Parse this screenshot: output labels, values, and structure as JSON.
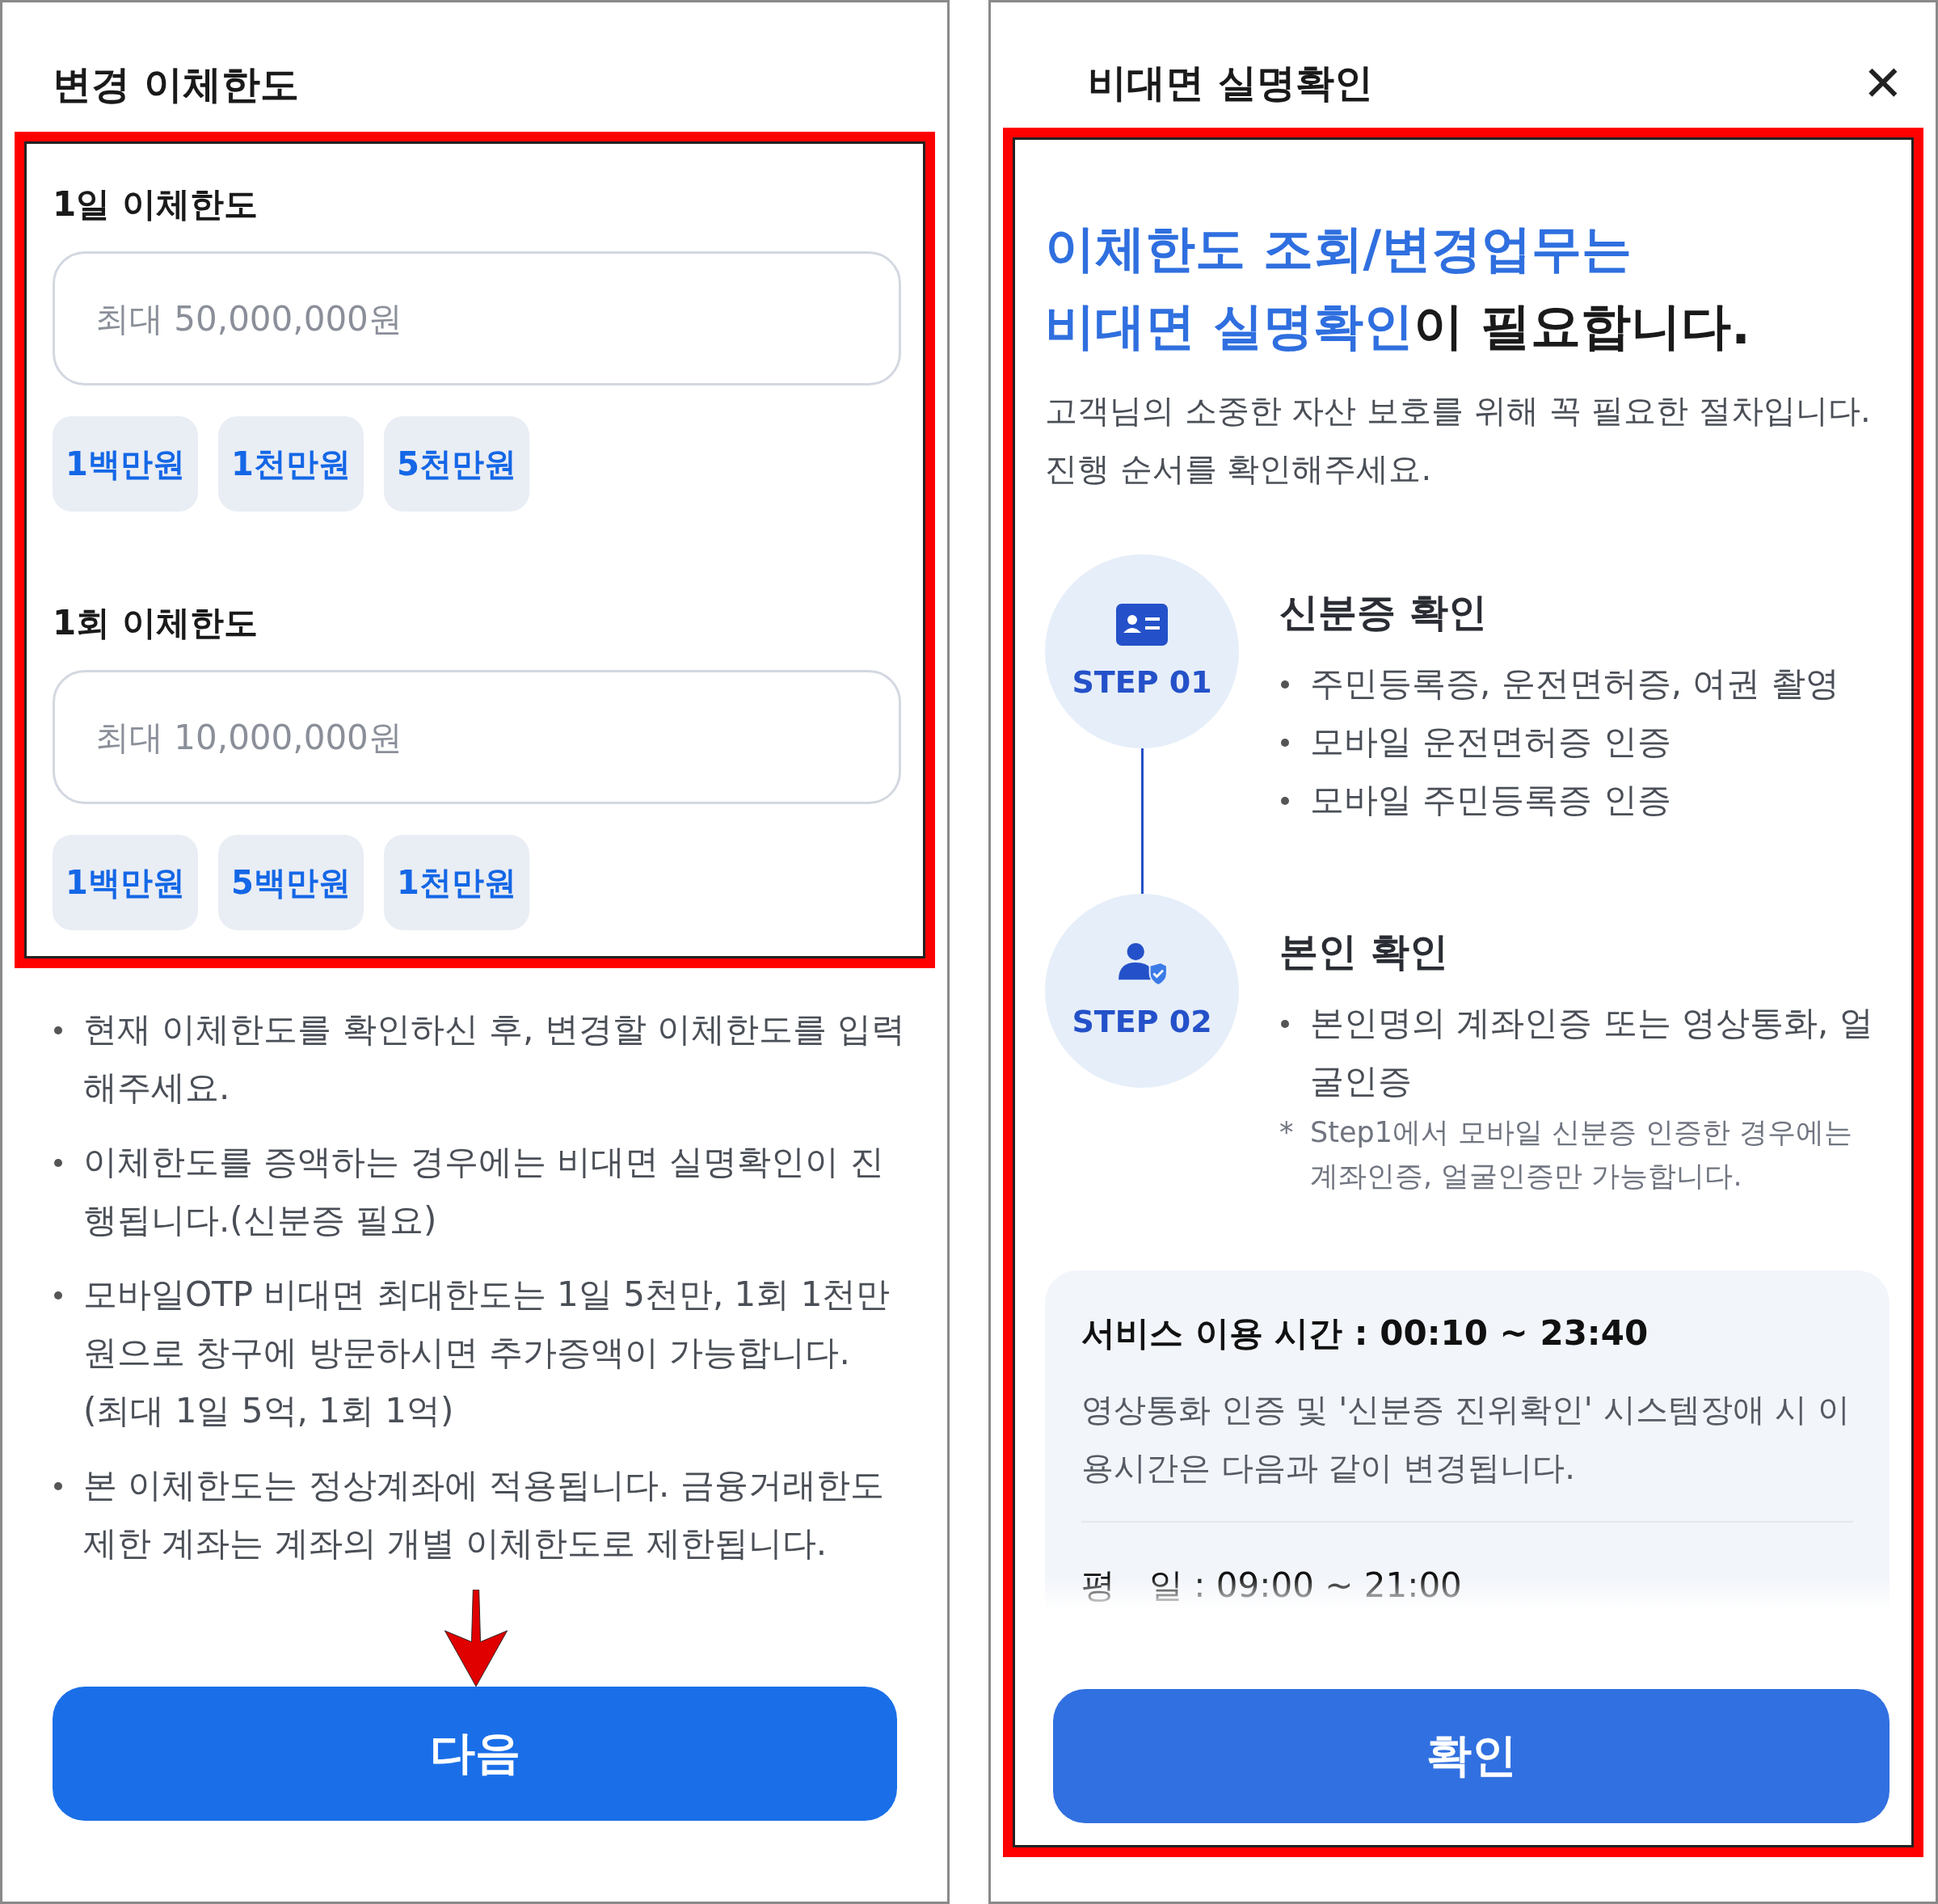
{
  "left": {
    "title": "변경 이체한도",
    "sections": [
      {
        "label": "1일 이체한도",
        "placeholder": "최대 50,000,000원",
        "chips": [
          "1백만원",
          "1천만원",
          "5천만원"
        ]
      },
      {
        "label": "1회 이체한도",
        "placeholder": "최대 10,000,000원",
        "chips": [
          "1백만원",
          "5백만원",
          "1천만원"
        ]
      }
    ],
    "notes": [
      "현재 이체한도를 확인하신 후, 변경할 이체한도를 입력해주세요.",
      "이체한도를 증액하는 경우에는 비대면 실명확인이 진행됩니다.(신분증 필요)",
      "모바일OTP 비대면 최대한도는 1일 5천만, 1회 1천만원으로 창구에 방문하시면 추가증액이 가능합니다. (최대 1일 5억, 1회 1억)",
      "본 이체한도는 정상계좌에 적용됩니다. 금융거래한도제한 계좌는 계좌의 개별 이체한도로 제한됩니다."
    ],
    "button": "다음"
  },
  "right": {
    "title": "비대면 실명확인",
    "close": "✕",
    "headline": [
      "이체한도 조회/변경업무는",
      "비대면 실명확인",
      "이 필요합니다."
    ],
    "intro": "고객님의 소중한 자산 보호를 위해 꼭 필요한 절차입니다. 진행 순서를 확인해주세요.",
    "steps": [
      {
        "kind": "id-card",
        "label": "STEP 01",
        "title": "신분증 확인",
        "bullets": [
          "주민등록증, 운전면허증, 여권 촬영",
          "모바일 운전면허증 인증",
          "모바일 주민등록증 인증"
        ]
      },
      {
        "kind": "person-check",
        "label": "STEP 02",
        "title": "본인 확인",
        "bullets": [
          "본인명의 계좌인증 또는 영상통화, 얼굴인증"
        ],
        "note_mark": "*",
        "note": "Step1에서 모바일 신분증 인증한 경우에는 계좌인증, 얼굴인증만 가능합니다."
      }
    ],
    "hours": {
      "title": "서비스 이용 시간 : 00:10 ~ 23:40",
      "text": "영상통화 인증 및 '신분증 진위확인' 시스템장애 시 이용시간은 다음과 같이 변경됩니다.",
      "rows": [
        {
          "day": "평　일",
          "time": ": 09:00 ~ 21:00"
        }
      ]
    },
    "button": "확인"
  }
}
